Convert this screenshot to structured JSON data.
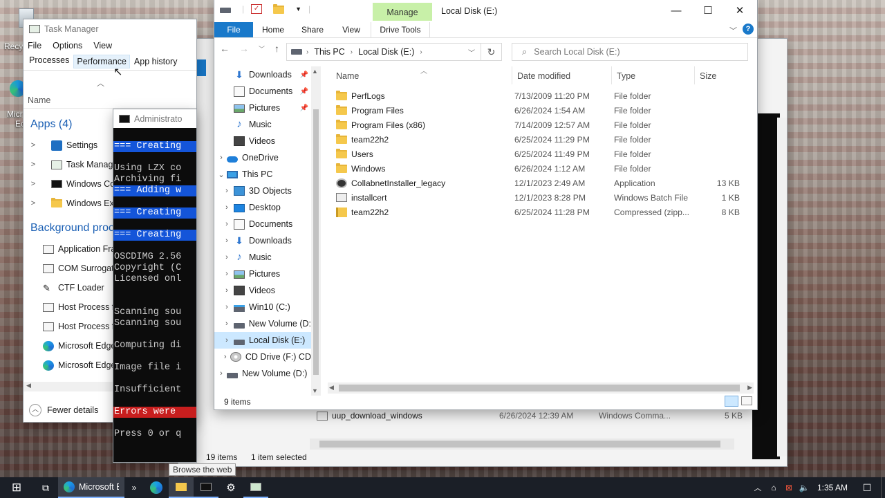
{
  "desktop": {
    "recycle_label": "Recy",
    "edge_label_1": "Micr",
    "edge_label_2": "Ec"
  },
  "task_manager": {
    "title": "Task Manager",
    "menu": [
      "File",
      "Options",
      "View"
    ],
    "tabs": [
      "Processes",
      "Performance",
      "App history"
    ],
    "col_name": "Name",
    "apps_header": "Apps (4)",
    "apps": [
      "Settings",
      "Task Manager",
      "Windows Com",
      "Windows Explo"
    ],
    "bg_header": "Background proc",
    "bg": [
      "Application Fra",
      "COM Surrogat",
      "CTF Loader",
      "Host Process fo",
      "Host Process fo",
      "Microsoft Edge",
      "Microsoft Edge"
    ],
    "fewer_details": "Fewer details"
  },
  "cmd": {
    "title": "Administrato",
    "lines": [
      {
        "text": "=== Creating",
        "style": "hl"
      },
      {
        "text": "",
        "style": ""
      },
      {
        "text": "Using LZX co",
        "style": ""
      },
      {
        "text": "Archiving fi",
        "style": ""
      },
      {
        "text": "=== Adding w",
        "style": "hl"
      },
      {
        "text": "",
        "style": ""
      },
      {
        "text": "=== Creating",
        "style": "hl"
      },
      {
        "text": "",
        "style": ""
      },
      {
        "text": "=== Creating",
        "style": "hl"
      },
      {
        "text": "",
        "style": ""
      },
      {
        "text": "OSCDIMG 2.56",
        "style": ""
      },
      {
        "text": "Copyright (C",
        "style": ""
      },
      {
        "text": "Licensed onl",
        "style": ""
      },
      {
        "text": "",
        "style": ""
      },
      {
        "text": "",
        "style": ""
      },
      {
        "text": "Scanning sou",
        "style": ""
      },
      {
        "text": "Scanning sou",
        "style": ""
      },
      {
        "text": "",
        "style": ""
      },
      {
        "text": "Computing di",
        "style": ""
      },
      {
        "text": "",
        "style": ""
      },
      {
        "text": "Image file i",
        "style": ""
      },
      {
        "text": "",
        "style": ""
      },
      {
        "text": "Insufficient",
        "style": ""
      },
      {
        "text": "",
        "style": ""
      },
      {
        "text": "Errors were ",
        "style": "err"
      },
      {
        "text": "",
        "style": ""
      },
      {
        "text": "Press 0 or q",
        "style": ""
      }
    ]
  },
  "back_explorer": {
    "file_name": "uup_download_windows",
    "file_date": "6/26/2024 12:39 AM",
    "file_type": "Windows Comma...",
    "file_size": "5 KB",
    "items_count": "19 items",
    "selected": "1 item selected",
    "partial_19": "19",
    "tab_f": "F"
  },
  "explorer": {
    "title": "Local Disk (E:)",
    "manage_tab": "Manage",
    "ribbon_tabs": [
      "File",
      "Home",
      "Share",
      "View",
      "Drive Tools"
    ],
    "breadcrumb": [
      "This PC",
      "Local Disk (E:)"
    ],
    "search_placeholder": "Search Local Disk (E:)",
    "columns": {
      "name": "Name",
      "date": "Date modified",
      "type": "Type",
      "size": "Size"
    },
    "nav": [
      {
        "label": "Downloads",
        "icon": "download-icon",
        "indent": 1,
        "pin": true,
        "chev": ""
      },
      {
        "label": "Documents",
        "icon": "document-icon",
        "indent": 1,
        "pin": true,
        "chev": ""
      },
      {
        "label": "Pictures",
        "icon": "pictures-icon",
        "indent": 1,
        "pin": true,
        "chev": ""
      },
      {
        "label": "Music",
        "icon": "music-icon",
        "indent": 1,
        "pin": false,
        "chev": ""
      },
      {
        "label": "Videos",
        "icon": "videos-icon",
        "indent": 1,
        "pin": false,
        "chev": ""
      },
      {
        "label": "OneDrive",
        "icon": "onedrive-icon",
        "indent": 0,
        "pin": false,
        "chev": ">"
      },
      {
        "label": "This PC",
        "icon": "this-pc-icon",
        "indent": 0,
        "pin": false,
        "chev": "v"
      },
      {
        "label": "3D Objects",
        "icon": "3d-objects-icon",
        "indent": 1,
        "pin": false,
        "chev": ">"
      },
      {
        "label": "Desktop",
        "icon": "desktop-icon",
        "indent": 1,
        "pin": false,
        "chev": ">"
      },
      {
        "label": "Documents",
        "icon": "document-icon",
        "indent": 1,
        "pin": false,
        "chev": ">"
      },
      {
        "label": "Downloads",
        "icon": "download-icon",
        "indent": 1,
        "pin": false,
        "chev": ">"
      },
      {
        "label": "Music",
        "icon": "music-icon",
        "indent": 1,
        "pin": false,
        "chev": ">"
      },
      {
        "label": "Pictures",
        "icon": "pictures-icon",
        "indent": 1,
        "pin": false,
        "chev": ">"
      },
      {
        "label": "Videos",
        "icon": "videos-icon",
        "indent": 1,
        "pin": false,
        "chev": ">"
      },
      {
        "label": "Win10 (C:)",
        "icon": "win10-drive-icon",
        "indent": 1,
        "pin": false,
        "chev": ">"
      },
      {
        "label": "New Volume (D:",
        "icon": "drive-icon",
        "indent": 1,
        "pin": false,
        "chev": ">"
      },
      {
        "label": "Local Disk (E:)",
        "icon": "drive-icon",
        "indent": 1,
        "pin": false,
        "chev": ">",
        "selected": true
      },
      {
        "label": "CD Drive (F:) CD",
        "icon": "cd-drive-icon",
        "indent": 1,
        "pin": false,
        "chev": ">"
      },
      {
        "label": "New Volume (D:)",
        "icon": "drive-icon",
        "indent": 0,
        "pin": false,
        "chev": ">"
      }
    ],
    "files": [
      {
        "name": "PerfLogs",
        "date": "7/13/2009 11:20 PM",
        "type": "File folder",
        "size": "",
        "icon": "folder-icon"
      },
      {
        "name": "Program Files",
        "date": "6/26/2024 1:54 AM",
        "type": "File folder",
        "size": "",
        "icon": "folder-icon"
      },
      {
        "name": "Program Files (x86)",
        "date": "7/14/2009 12:57 AM",
        "type": "File folder",
        "size": "",
        "icon": "folder-icon"
      },
      {
        "name": "team22h2",
        "date": "6/25/2024 11:29 PM",
        "type": "File folder",
        "size": "",
        "icon": "folder-icon"
      },
      {
        "name": "Users",
        "date": "6/25/2024 11:49 PM",
        "type": "File folder",
        "size": "",
        "icon": "folder-icon"
      },
      {
        "name": "Windows",
        "date": "6/26/2024 1:12 AM",
        "type": "File folder",
        "size": "",
        "icon": "folder-icon"
      },
      {
        "name": "CollabnetInstaller_legacy",
        "date": "12/1/2023 2:49 AM",
        "type": "Application",
        "size": "13 KB",
        "icon": "application-icon"
      },
      {
        "name": "installcert",
        "date": "12/1/2023 8:28 PM",
        "type": "Windows Batch File",
        "size": "1 KB",
        "icon": "batch-file-icon"
      },
      {
        "name": "team22h2",
        "date": "6/25/2024 11:28 PM",
        "type": "Compressed (zipp...",
        "size": "8 KB",
        "icon": "zip-icon"
      }
    ],
    "status_items": "9 items"
  },
  "taskbar": {
    "edge_button": "Microsoft Ed",
    "overflow": "»",
    "tooltip": "Browse the web",
    "time": "1:35 AM"
  },
  "colors": {
    "accent": "#1979ca",
    "manage_tab": "#c8f0a8",
    "selection": "#cce8ff",
    "cmd_hl": "#1455d9",
    "cmd_err": "#c81e1e",
    "taskbar": "#1b1f27"
  }
}
